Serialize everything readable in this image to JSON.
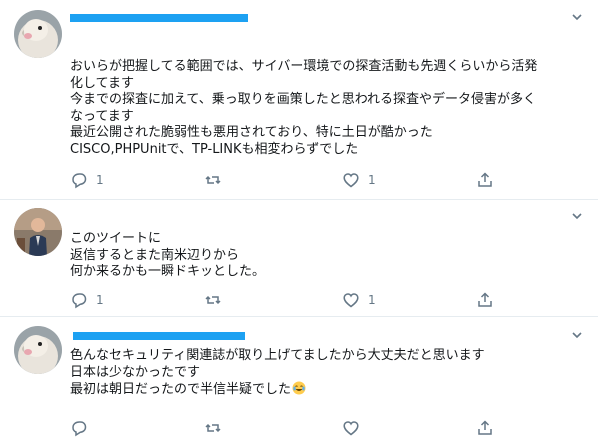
{
  "tweets": [
    {
      "lines": [
        "おいらが把握してる範囲では、サイバー環境での探査活動も先週くらいから活発",
        "化してます",
        "今までの探査に加えて、乗っ取りを画策したと思われる探査やデータ侵害が多く",
        "なってます",
        "最近公開された脆弱性も悪用されており、特に土日が酷かった",
        "CISCO,PHPUnitで、TP-LINKも相変わらずでした"
      ],
      "reply_count": "1",
      "retweet_count": "",
      "like_count": "1"
    },
    {
      "lines": [
        "このツイートに",
        "返信するとまた南米辺りから",
        "何か来るかも一瞬ドキッとした。"
      ],
      "reply_count": "1",
      "retweet_count": "",
      "like_count": "1"
    },
    {
      "lines": [
        "色んなセキュリティ関連誌が取り上げてましたから大丈夫だと思います",
        "日本は少なかったです",
        "最初は朝日だったので半信半疑でした"
      ],
      "emoji": "joy-emoji",
      "reply_count": "",
      "retweet_count": "",
      "like_count": ""
    }
  ],
  "colors": {
    "accent": "#1da1f2",
    "icon_gray": "#657786",
    "divider": "#e6ecf0"
  },
  "icons": [
    "reply-icon",
    "retweet-icon",
    "like-icon",
    "share-icon",
    "caret-down-icon"
  ]
}
